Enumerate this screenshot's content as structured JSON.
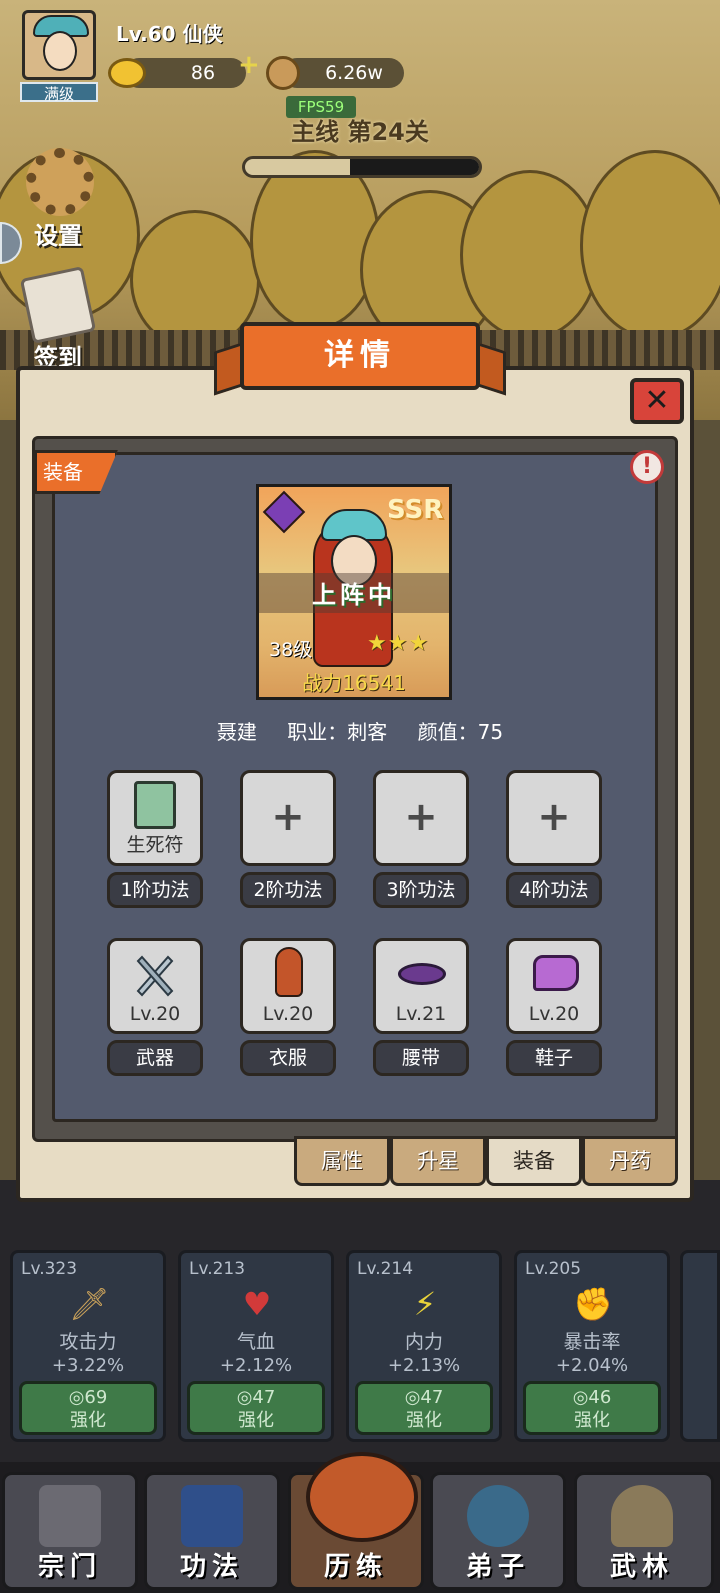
{
  "hud": {
    "player_level": "Lv.60 仙侠",
    "avatar_badge": "满级",
    "gold_ingots": "86",
    "coins": "6.26w",
    "fps": "FPS59",
    "stage_title": "主线 第24关",
    "stage_progress": 0.55
  },
  "side_buttons": {
    "settings": "设置",
    "signin": "签到"
  },
  "dialog": {
    "title": "详情",
    "close": "✕",
    "section_tag": "装备",
    "info": "!"
  },
  "hero_card": {
    "rarity": "SSR",
    "status": "上阵中",
    "level": "38级",
    "stars": "★★★",
    "star_count": 3,
    "power": "战力16541"
  },
  "hero_info": {
    "name": "聂建",
    "class": "职业：刺客",
    "looks": "颜值：75"
  },
  "skill_slots": [
    {
      "content": "生死符",
      "label": "1阶功法",
      "filled": true
    },
    {
      "content": "+",
      "label": "2阶功法",
      "filled": false
    },
    {
      "content": "+",
      "label": "3阶功法",
      "filled": false
    },
    {
      "content": "+",
      "label": "4阶功法",
      "filled": false
    }
  ],
  "equip_slots": [
    {
      "level": "Lv.20",
      "label": "武器",
      "icon": "weapon-icon"
    },
    {
      "level": "Lv.20",
      "label": "衣服",
      "icon": "costume-icon"
    },
    {
      "level": "Lv.21",
      "label": "腰带",
      "icon": "belt-icon"
    },
    {
      "level": "Lv.20",
      "label": "鞋子",
      "icon": "boots-icon"
    }
  ],
  "tabs": [
    "属性",
    "升星",
    "装备",
    "丹药"
  ],
  "active_tab": "装备",
  "stats": [
    {
      "level": "Lv.323",
      "name": "攻击力",
      "pct": "+3.22%",
      "cost": "69",
      "action": "强化",
      "icon": "sword-icon"
    },
    {
      "level": "Lv.213",
      "name": "气血",
      "pct": "+2.12%",
      "cost": "47",
      "action": "强化",
      "icon": "heart-icon"
    },
    {
      "level": "Lv.214",
      "name": "内力",
      "pct": "+2.13%",
      "cost": "47",
      "action": "强化",
      "icon": "lightning-icon"
    },
    {
      "level": "Lv.205",
      "name": "暴击率",
      "pct": "+2.04%",
      "cost": "46",
      "action": "强化",
      "icon": "fist-icon"
    }
  ],
  "bottom_nav": [
    "宗门",
    "功法",
    "历练",
    "弟子",
    "武林"
  ],
  "colors": {
    "accent_orange": "#ea6f2a",
    "close_red": "#d8443a",
    "panel": "#535a6d",
    "button_green": "#3f7a48"
  }
}
